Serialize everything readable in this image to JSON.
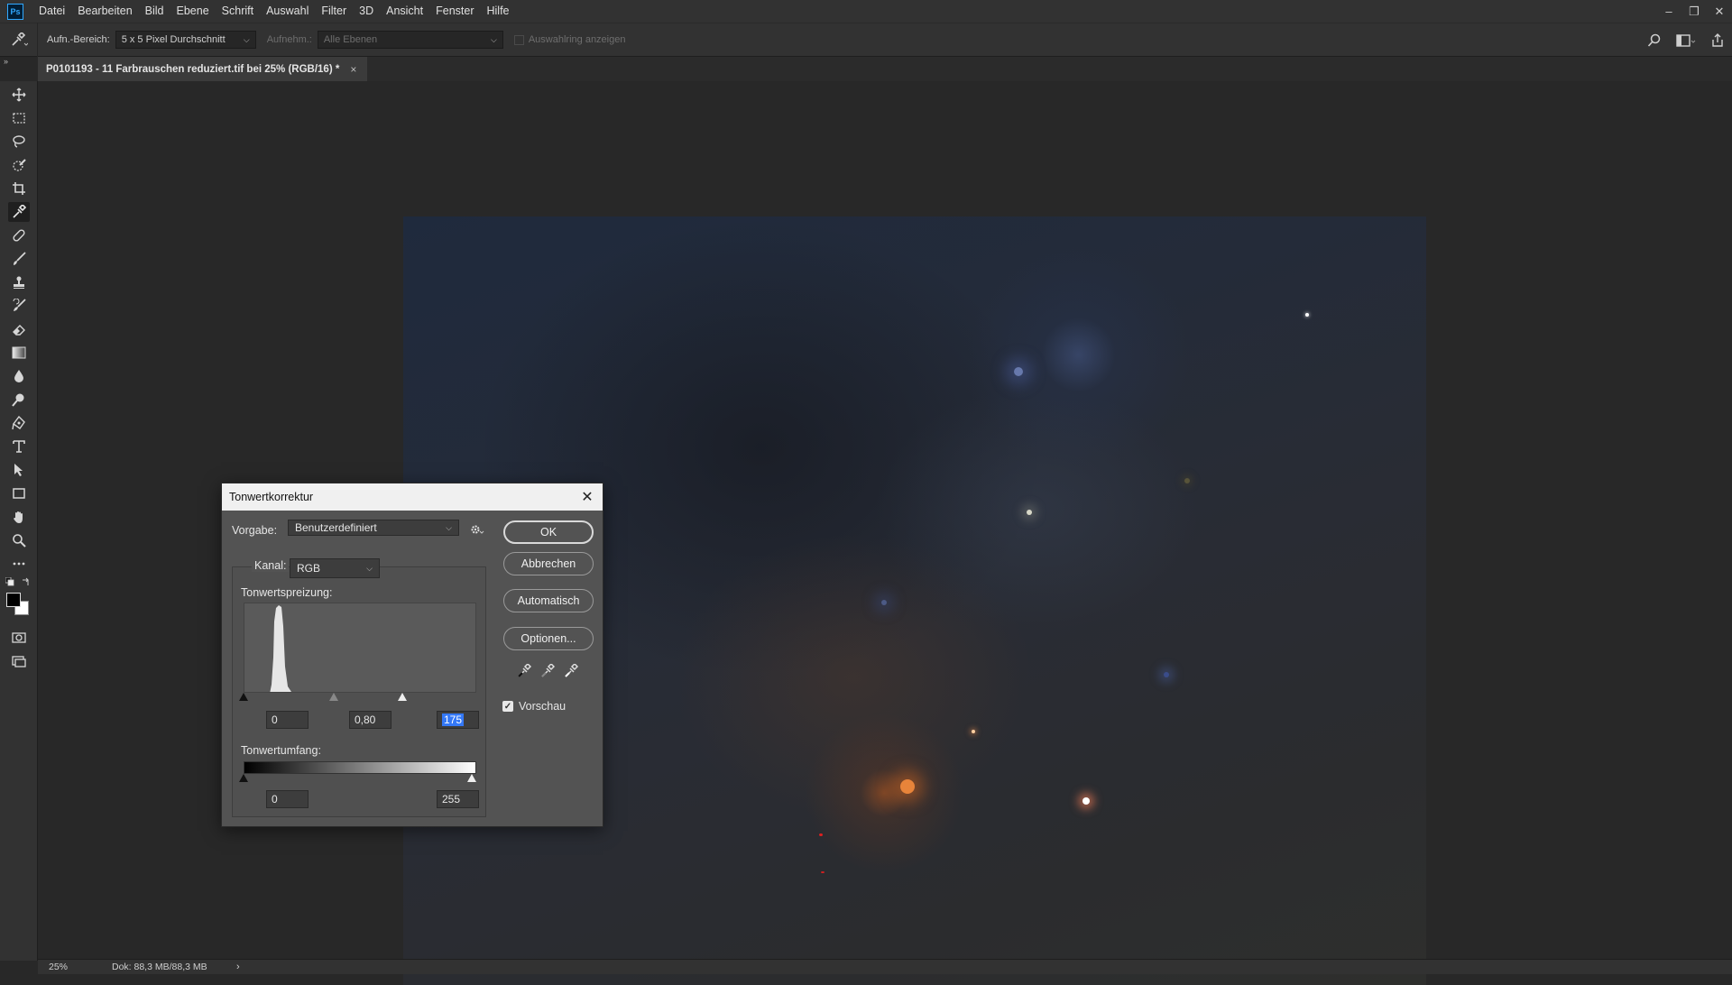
{
  "app": {
    "logo_text": "Ps"
  },
  "menu": [
    "Datei",
    "Bearbeiten",
    "Bild",
    "Ebene",
    "Schrift",
    "Auswahl",
    "Filter",
    "3D",
    "Ansicht",
    "Fenster",
    "Hilfe"
  ],
  "options": {
    "sample_size_label": "Aufn.-Bereich:",
    "sample_size_value": "5 x 5 Pixel Durchschnitt",
    "sample_label": "Aufnehm.:",
    "sample_value": "Alle Ebenen",
    "show_ring_label": "Auswahlring anzeigen"
  },
  "document_tab": {
    "title": "P0101193 - 11 Farbrauschen reduziert.tif bei 25% (RGB/16) *",
    "close": "×"
  },
  "status": {
    "zoom": "25%",
    "doc": "Dok: 88,3 MB/88,3 MB",
    "arrow": "›"
  },
  "dialog": {
    "title": "Tonwertkorrektur",
    "preset_label": "Vorgabe:",
    "preset_value": "Benutzerdefiniert",
    "channel_label": "Kanal:",
    "channel_value": "RGB",
    "input_levels_label": "Tonwertspreizung:",
    "input_black": "0",
    "input_gamma": "0,80",
    "input_white": "175",
    "input_black_level": 0,
    "input_gamma_level": 0.8,
    "input_white_level": 175,
    "output_levels_label": "Tonwertumfang:",
    "output_black": "0",
    "output_white": "255",
    "output_black_level": 0,
    "output_white_level": 255,
    "buttons": {
      "ok": "OK",
      "cancel": "Abbrechen",
      "auto": "Automatisch",
      "options": "Optionen..."
    },
    "preview_label": "Vorschau",
    "preview_checked": true
  }
}
